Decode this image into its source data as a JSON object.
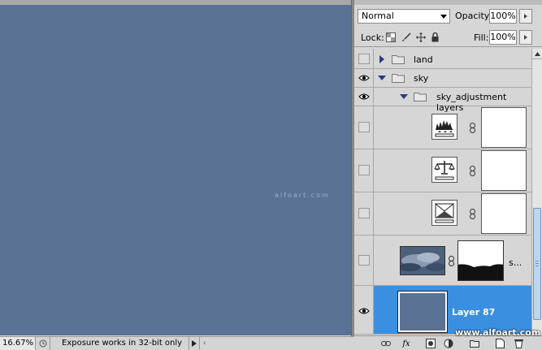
{
  "canvas": {
    "background": "#5a7294",
    "watermark": "alfoart.com"
  },
  "status": {
    "zoom": "16.67%",
    "message": "Exposure works in 32-bit only"
  },
  "panel": {
    "blend_mode": "Normal",
    "opacity_label": "Opacity:",
    "opacity_value": "100%",
    "lock_label": "Lock:",
    "fill_label": "Fill:",
    "fill_value": "100%"
  },
  "layers": [
    {
      "name": "land",
      "type": "group",
      "visible": false,
      "expanded": false
    },
    {
      "name": "sky",
      "type": "group",
      "visible": true,
      "expanded": true
    },
    {
      "name": "sky_adjustment layers",
      "type": "group",
      "visible": true,
      "expanded": true
    },
    {
      "name": "",
      "type": "adjustment",
      "icon": "levels-icon",
      "visible": false
    },
    {
      "name": "",
      "type": "adjustment",
      "icon": "color-balance-icon",
      "visible": false
    },
    {
      "name": "",
      "type": "adjustment",
      "icon": "exposure-icon",
      "visible": false
    },
    {
      "name": "s...",
      "type": "image",
      "visible": false
    },
    {
      "name": "Layer 87",
      "type": "fill",
      "visible": true,
      "selected": true
    }
  ],
  "site_watermark": "www.alfoart.com",
  "colors": {
    "selection": "#3b8fe0",
    "canvas": "#5a7294"
  }
}
